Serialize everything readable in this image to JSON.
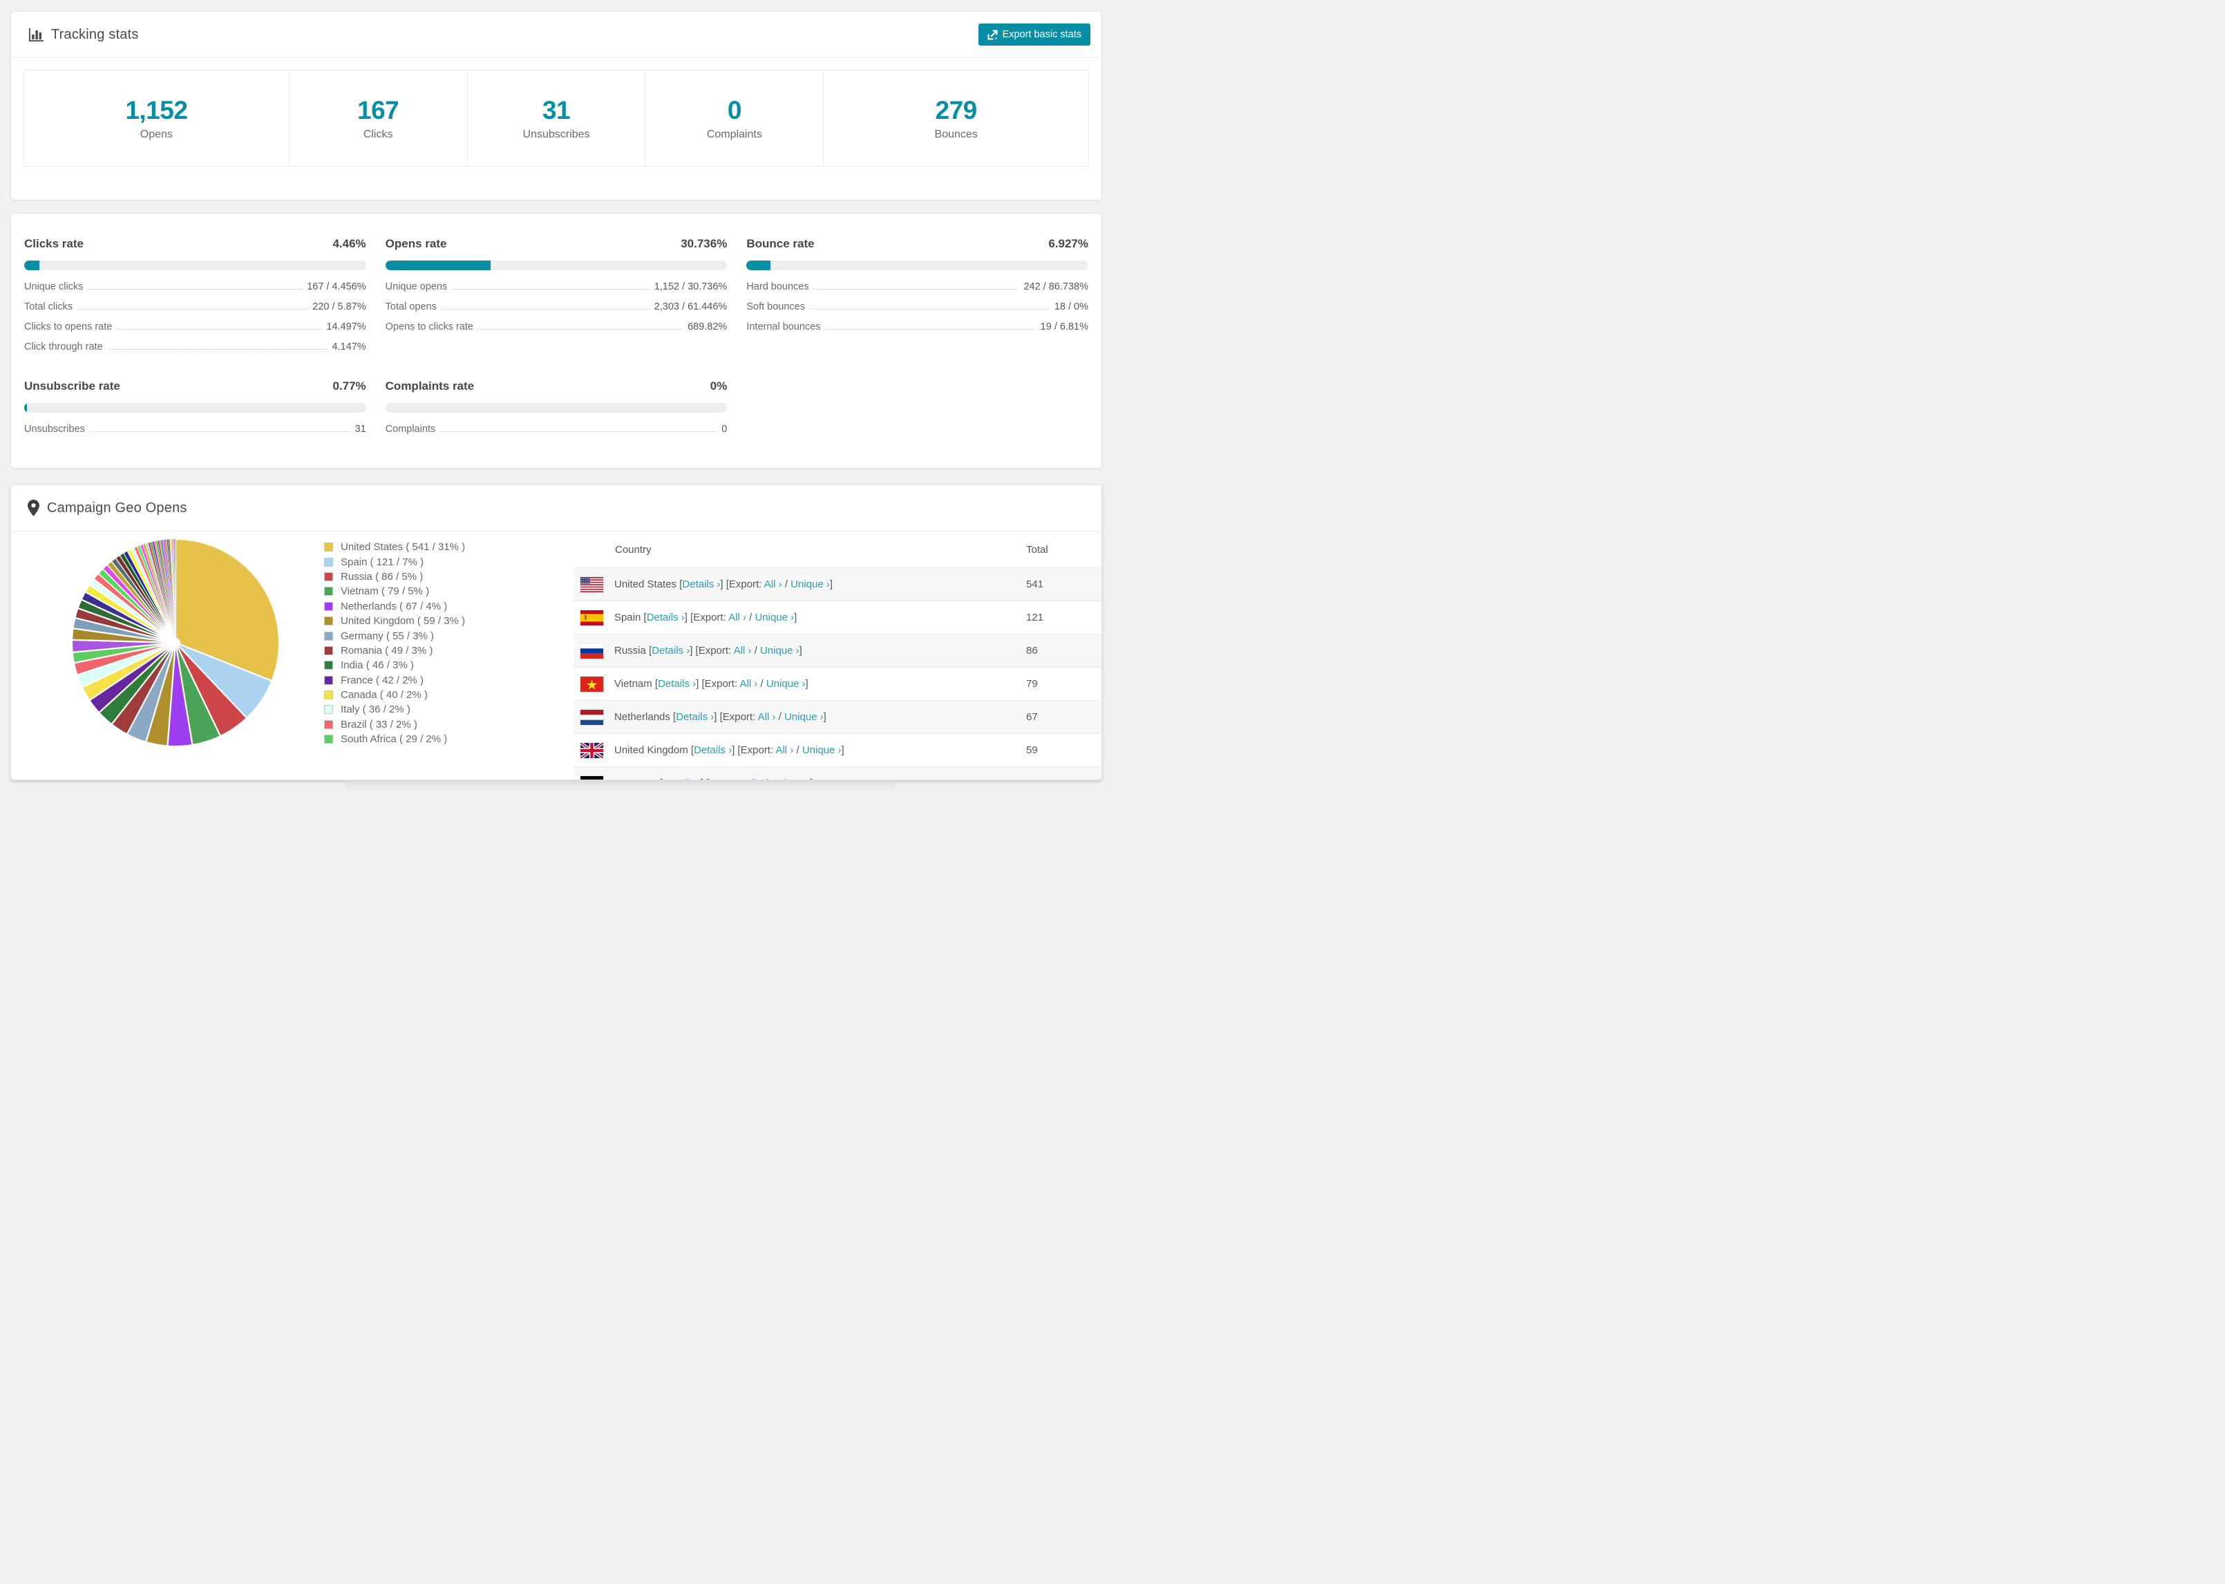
{
  "colors": {
    "accent": "#078da4",
    "link": "#2b9db2",
    "track": "#eceef0",
    "stripe": "#f7f7f8"
  },
  "tracking": {
    "title": "Tracking stats",
    "export_button": "Export basic stats",
    "summary": [
      {
        "value": "1,152",
        "label": "Opens"
      },
      {
        "value": "167",
        "label": "Clicks"
      },
      {
        "value": "31",
        "label": "Unsubscribes"
      },
      {
        "value": "0",
        "label": "Complaints"
      },
      {
        "value": "279",
        "label": "Bounces"
      }
    ]
  },
  "rates": [
    {
      "title": "Clicks rate",
      "value": "4.46%",
      "percent": 4.46,
      "rows": [
        {
          "label": "Unique clicks",
          "value": "167 / 4.456%"
        },
        {
          "label": "Total clicks",
          "value": "220 / 5.87%"
        },
        {
          "label": "Clicks to opens rate",
          "value": "14.497%"
        },
        {
          "label": "Click through rate",
          "value": "4.147%"
        }
      ]
    },
    {
      "title": "Opens rate",
      "value": "30.736%",
      "percent": 30.736,
      "rows": [
        {
          "label": "Unique opens",
          "value": "1,152 / 30.736%"
        },
        {
          "label": "Total opens",
          "value": "2,303 / 61.446%"
        },
        {
          "label": "Opens to clicks rate",
          "value": "689.82%"
        }
      ]
    },
    {
      "title": "Bounce rate",
      "value": "6.927%",
      "percent": 6.927,
      "rows": [
        {
          "label": "Hard bounces",
          "value": "242 / 86.738%"
        },
        {
          "label": "Soft bounces",
          "value": "18 / 0%"
        },
        {
          "label": "Internal bounces",
          "value": "19 / 6.81%"
        }
      ]
    },
    {
      "title": "Unsubscribe rate",
      "value": "0.77%",
      "percent": 0.77,
      "rows": [
        {
          "label": "Unsubscribes",
          "value": "31"
        }
      ]
    },
    {
      "title": "Complaints rate",
      "value": "0%",
      "percent": 0,
      "rows": [
        {
          "label": "Complaints",
          "value": "0"
        }
      ]
    }
  ],
  "geo": {
    "title": "Campaign Geo Opens",
    "columns": {
      "country": "Country",
      "total": "Total"
    },
    "links": {
      "details": "Details ›",
      "export_label": "Export:",
      "all": "All ›",
      "unique": "Unique ›"
    },
    "visible_rows": 7,
    "chart_data": {
      "type": "pie",
      "series": [
        {
          "name": "United States",
          "code": "us",
          "value": 541,
          "pct": "31%",
          "color": "#e7c24a"
        },
        {
          "name": "Spain",
          "code": "es",
          "value": 121,
          "pct": "7%",
          "color": "#abd3f0"
        },
        {
          "name": "Russia",
          "code": "ru",
          "value": 86,
          "pct": "5%",
          "color": "#cc4549"
        },
        {
          "name": "Vietnam",
          "code": "vn",
          "value": 79,
          "pct": "5%",
          "color": "#4ba457"
        },
        {
          "name": "Netherlands",
          "code": "nl",
          "value": 67,
          "pct": "4%",
          "color": "#9d3ff0"
        },
        {
          "name": "United Kingdom",
          "code": "gb",
          "value": 59,
          "pct": "3%",
          "color": "#b08f2e"
        },
        {
          "name": "Germany",
          "code": "de",
          "value": 55,
          "pct": "3%",
          "color": "#8aa8c2"
        },
        {
          "name": "Romania",
          "code": "ro",
          "value": 49,
          "pct": "3%",
          "color": "#9e3c3c"
        },
        {
          "name": "India",
          "code": "in",
          "value": 46,
          "pct": "3%",
          "color": "#2f7d3a"
        },
        {
          "name": "France",
          "code": "fr",
          "value": 42,
          "pct": "2%",
          "color": "#66279e"
        },
        {
          "name": "Canada",
          "code": "ca",
          "value": 40,
          "pct": "2%",
          "color": "#f6e14b"
        },
        {
          "name": "Italy",
          "code": "it",
          "value": 36,
          "pct": "2%",
          "color": "#dcfcf7"
        },
        {
          "name": "Brazil",
          "code": "br",
          "value": 33,
          "pct": "2%",
          "color": "#f2646c"
        },
        {
          "name": "South Africa",
          "code": "za",
          "value": 29,
          "pct": "2%",
          "color": "#5ecb63"
        }
      ],
      "others": {
        "total": 462,
        "slice_count": 48,
        "decay": 0.93,
        "colors": [
          "#a855e0",
          "#a8882c",
          "#7f9cb8",
          "#97383a",
          "#2e6b34",
          "#3b2f8f",
          "#f2ea3f",
          "#e2fbf7",
          "#f56a6a",
          "#5ad65a",
          "#e049e8",
          "#c2a22e",
          "#546e7a",
          "#7a2e2e",
          "#1e5c28",
          "#2b2b8a",
          "#f7f73f",
          "#d8f7f2",
          "#ff7070",
          "#66e366",
          "#ee55ee",
          "#d4af37",
          "#aed6f1",
          "#cd4c4c",
          "#4caf50",
          "#8a2be2",
          "#e8a23c",
          "#35b0a8",
          "#e0315a",
          "#9acd32",
          "#4666ff",
          "#f066b8"
        ]
      },
      "legend_position": "right"
    }
  }
}
